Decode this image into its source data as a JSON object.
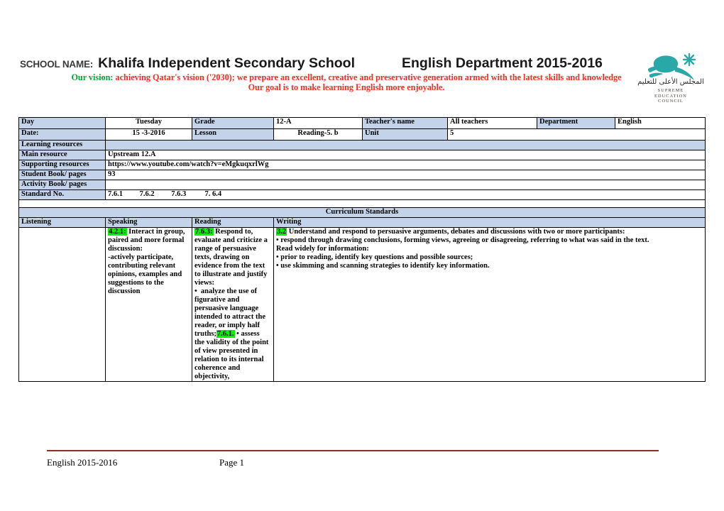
{
  "header": {
    "school_label": "SCHOOL NAME:",
    "school_name": "Khalifa Independent Secondary School",
    "department_title": "English Department 2015-2016",
    "vision_label": "Our vision:",
    "vision_text": " achieving Qatar's vision ('2030); we prepare an excellent, creative and preservative generation armed with the latest skills and knowledge",
    "goal_text": "Our goal is to make learning English more enjoyable.",
    "colors": {
      "vision_label": "#00a933",
      "vision_text": "#ff2a1c",
      "table_shade": "#c2d3ea",
      "highlight": "#00f200",
      "logo_teal": "#2aa8a8",
      "footer_rule": "#8c2f23"
    }
  },
  "logo": {
    "name": "supreme-education-council-logo",
    "arabic": "المجلس الأعلى للتعليم",
    "line1": "SUPREME",
    "line2": "EDUCATION",
    "line3": "COUNCIL"
  },
  "info_table": {
    "row_day": {
      "label": "Day",
      "value": "Tuesday",
      "grade_label": "Grade",
      "grade_value": "12-A",
      "teacher_label": "Teacher's name",
      "teacher_value": "All teachers",
      "department_label": "Department",
      "department_value": "English"
    },
    "row_date": {
      "label": "Date:",
      "value": "15 -3-2016",
      "lesson_label": "Lesson",
      "lesson_value": "Reading-5. b",
      "unit_label": "Unit",
      "unit_value": "5"
    },
    "learning_resources_label": "Learning resources",
    "learning_resources_value": "",
    "main_resource_label": "Main resource",
    "main_resource_value": "Upstream 12.A",
    "supporting_resources_label": "Supporting resources",
    "supporting_resources_value": "https://www.youtube.com/watch?v=eMgkuqxrlWg",
    "student_book_label": "Student Book/ pages",
    "student_book_value": "93",
    "activity_book_label": "Activity Book/ pages",
    "activity_book_value": "",
    "standard_no_label": "Standard No.",
    "standard_no_value": "7.6.1         7.6.2         7.6.3          7. 6.4"
  },
  "curriculum": {
    "section_title": "Curriculum Standards",
    "columns": [
      {
        "header": "Listening",
        "code": "",
        "body": ""
      },
      {
        "header": "Speaking",
        "code": "4.2.1:",
        "body": " Interact in group, paired and more formal discussion:\n-actively participate, contributing relevant opinions, examples and suggestions to the discussion"
      },
      {
        "header": "Reading",
        "code": "7.6.3:",
        "body": " Respond to, evaluate and criticize a range of persuasive texts, drawing on evidence from the text to illustrate and justify views:\n•  analyze the use of figurative and persuasive language intended to attract the reader, or imply half truths;",
        "code2": "7.6.1.",
        "body2": " • assess the validity of the point of view presented in relation to its internal coherence and objectivity,"
      },
      {
        "header": "Writing",
        "code": "3.2",
        "body": " Understand and respond to persuasive arguments, debates and discussions with two or more participants:\n• respond through drawing conclusions, forming views, agreeing or disagreeing, referring to what was said in the text.\nRead widely for information:\n• prior to reading, identify key questions and possible sources;\n• use skimming and scanning strategies to identify key information."
      }
    ]
  },
  "footer": {
    "left": "English 2015-2016",
    "page": "Page 1"
  }
}
